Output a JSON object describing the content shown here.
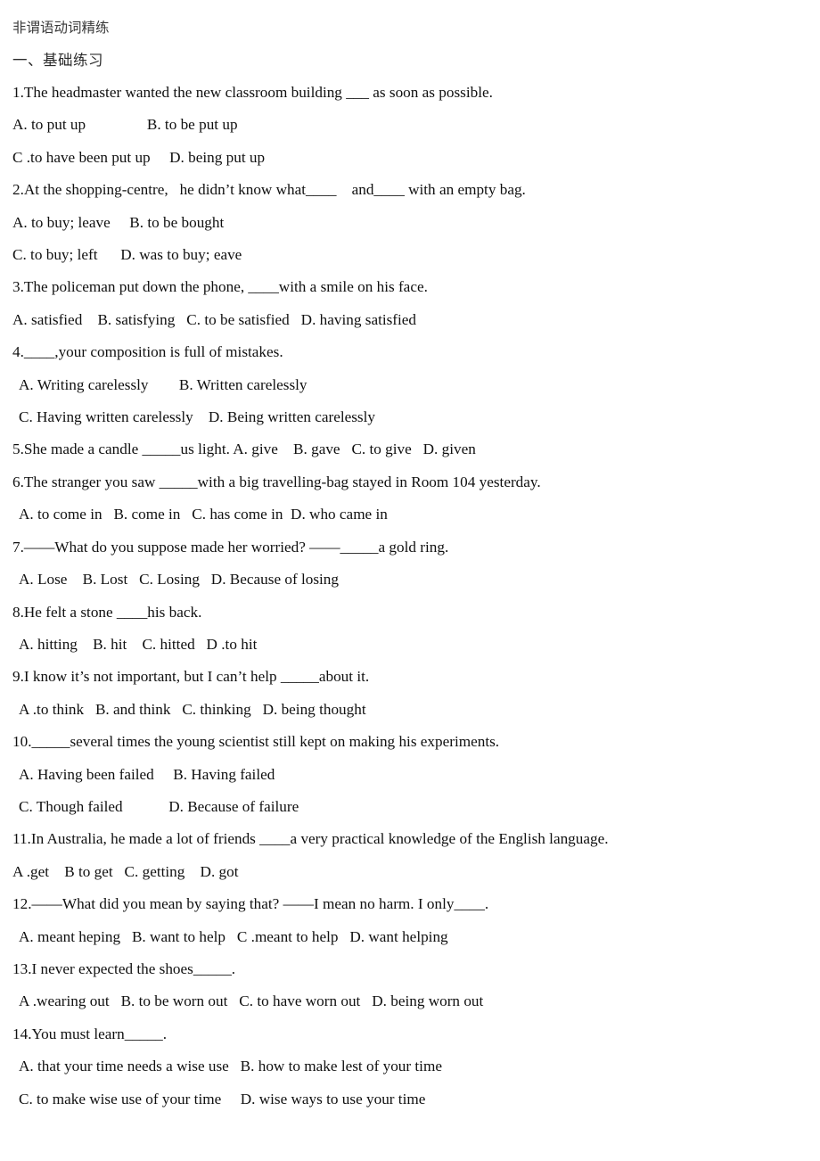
{
  "document": {
    "title": "非谓语动词精练",
    "section_heading": "一、基础练习"
  },
  "questions": [
    {
      "id": "q1",
      "stem": "1.The headmaster wanted the new classroom building ___ as soon as possible.",
      "option_lines": [
        {
          "text": "A. to put up                B. to be put up",
          "indented": false
        },
        {
          "text": "C .to have been put up     D. being put up",
          "indented": false
        }
      ]
    },
    {
      "id": "q2",
      "stem": "2.At the shopping-centre,   he didn’t know what____    and____ with an empty bag.",
      "option_lines": [
        {
          "text": "A. to buy; leave     B. to be bought",
          "indented": false
        },
        {
          "text": "C. to buy; left      D. was to buy; eave",
          "indented": false
        }
      ]
    },
    {
      "id": "q3",
      "stem": "3.The policeman put down the phone, ____with a smile on his face.",
      "option_lines": [
        {
          "text": "A. satisfied    B. satisfying   C. to be satisfied   D. having satisfied",
          "indented": false
        }
      ]
    },
    {
      "id": "q4",
      "stem": "4.____,your composition is full of mistakes.",
      "option_lines": [
        {
          "text": "A. Writing carelessly        B. Written carelessly",
          "indented": true
        },
        {
          "text": "C. Having written carelessly    D. Being written carelessly",
          "indented": true
        }
      ]
    },
    {
      "id": "q5",
      "stem": "5.She made a candle _____us light. A. give    B. gave   C. to give   D. given",
      "option_lines": []
    },
    {
      "id": "q6",
      "stem": "6.The stranger you saw _____with a big travelling-bag stayed in Room 104 yesterday.",
      "option_lines": [
        {
          "text": "A. to come in   B. come in   C. has come in  D. who came in",
          "indented": true
        }
      ]
    },
    {
      "id": "q7",
      "stem": "7.——What do you suppose made her worried? ——_____a gold ring.",
      "option_lines": [
        {
          "text": "A. Lose    B. Lost   C. Losing   D. Because of losing",
          "indented": true
        }
      ]
    },
    {
      "id": "q8",
      "stem": "8.He felt a stone ____his back.",
      "option_lines": [
        {
          "text": "A. hitting    B. hit    C. hitted   D .to hit",
          "indented": true
        }
      ]
    },
    {
      "id": "q9",
      "stem": "9.I know it’s not important, but I can’t help _____about it.",
      "option_lines": [
        {
          "text": "A .to think   B. and think   C. thinking   D. being thought",
          "indented": true
        }
      ]
    },
    {
      "id": "q10",
      "stem": "10._____several times the young scientist still kept on making his experiments.",
      "option_lines": [
        {
          "text": "A. Having been failed     B. Having failed",
          "indented": true
        },
        {
          "text": "C. Though failed            D. Because of failure",
          "indented": true
        }
      ]
    },
    {
      "id": "q11",
      "stem": "11.In Australia, he made a lot of friends ____a very practical knowledge of the English language.",
      "option_lines": [
        {
          "text": "A .get    B to get   C. getting    D. got",
          "indented": false
        }
      ]
    },
    {
      "id": "q12",
      "stem": "12.——What did you mean by saying that? ——I mean no harm. I only____.",
      "option_lines": [
        {
          "text": "A. meant heping   B. want to help   C .meant to help   D. want helping",
          "indented": true
        }
      ]
    },
    {
      "id": "q13",
      "stem": "13.I never expected the shoes_____.",
      "option_lines": [
        {
          "text": "A .wearing out   B. to be worn out   C. to have worn out   D. being worn out",
          "indented": true
        }
      ]
    },
    {
      "id": "q14",
      "stem": "14.You must learn_____.",
      "option_lines": [
        {
          "text": "A. that your time needs a wise use   B. how to make lest of your time",
          "indented": true
        },
        {
          "text": "C. to make wise use of your time     D. wise ways to use your time",
          "indented": true
        }
      ]
    }
  ]
}
